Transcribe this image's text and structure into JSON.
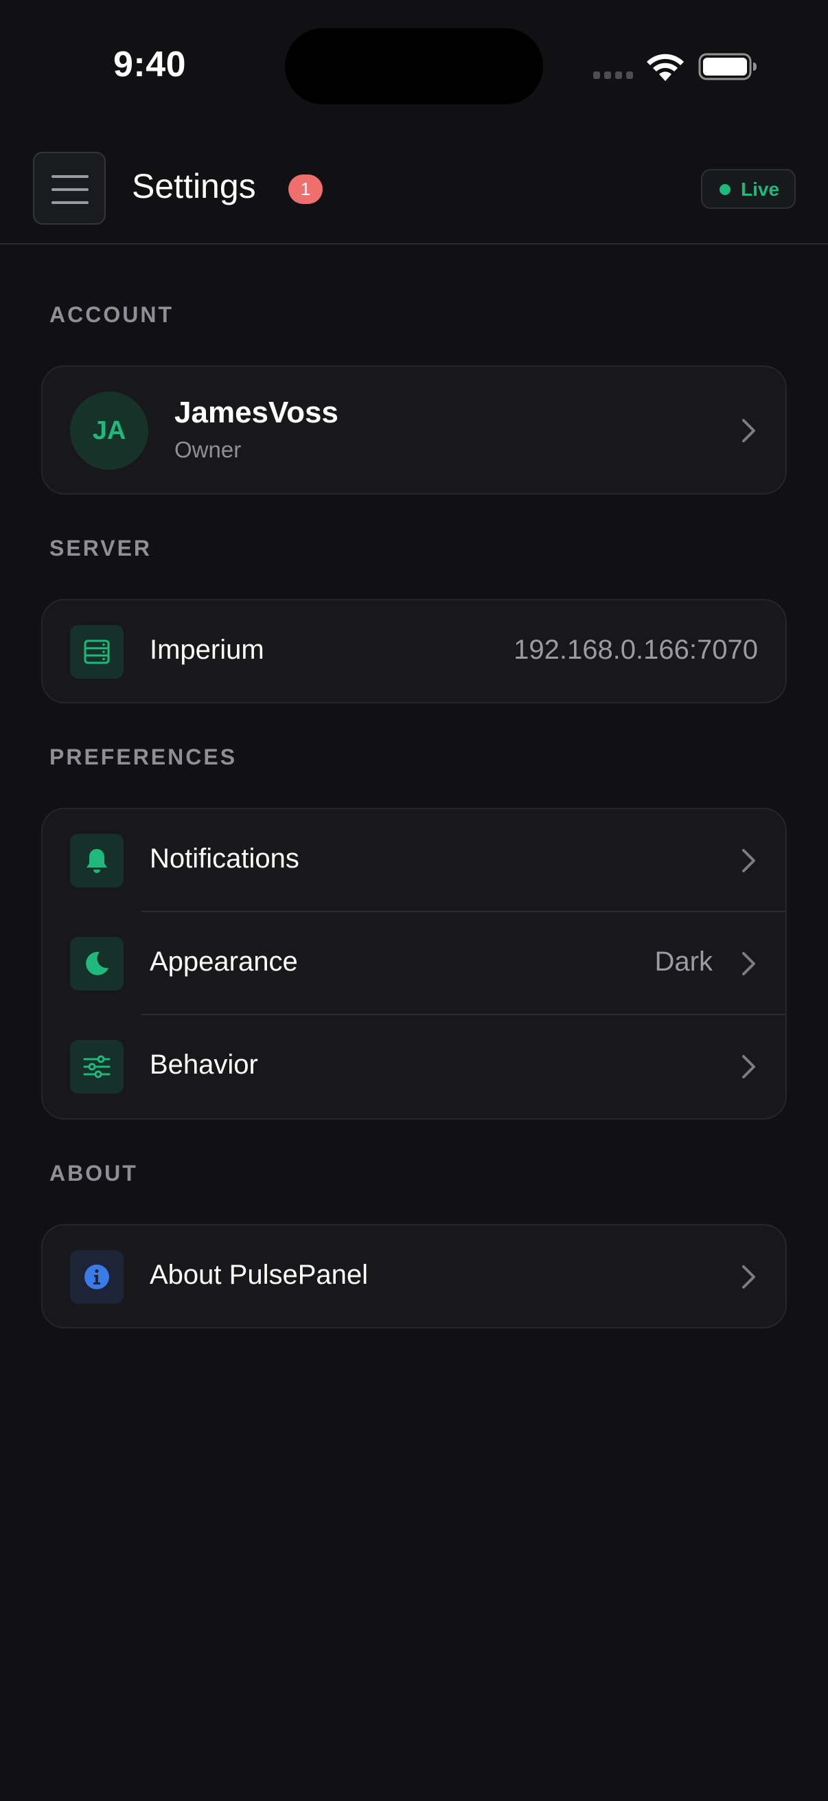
{
  "status_bar": {
    "time": "9:40"
  },
  "header": {
    "title": "Settings",
    "badge_count": "1",
    "live_label": "Live"
  },
  "sections": {
    "account": {
      "label": "ACCOUNT",
      "avatar_initials": "JA",
      "name": "JamesVoss",
      "role": "Owner"
    },
    "server": {
      "label": "SERVER",
      "name": "Imperium",
      "address": "192.168.0.166:7070",
      "icon": "server-icon"
    },
    "preferences": {
      "label": "PREFERENCES",
      "items": [
        {
          "label": "Notifications",
          "value": "",
          "icon": "bell-icon"
        },
        {
          "label": "Appearance",
          "value": "Dark",
          "icon": "moon-icon"
        },
        {
          "label": "Behavior",
          "value": "",
          "icon": "sliders-icon"
        }
      ]
    },
    "about": {
      "label": "ABOUT",
      "item_label": "About PulsePanel",
      "icon": "info-icon"
    }
  },
  "colors": {
    "background": "#111113",
    "card": "#18181b",
    "accent": "#1fb97e",
    "badge": "#ef6e6e",
    "info_blue": "#3b7be8",
    "muted_text": "#8e8f97"
  }
}
